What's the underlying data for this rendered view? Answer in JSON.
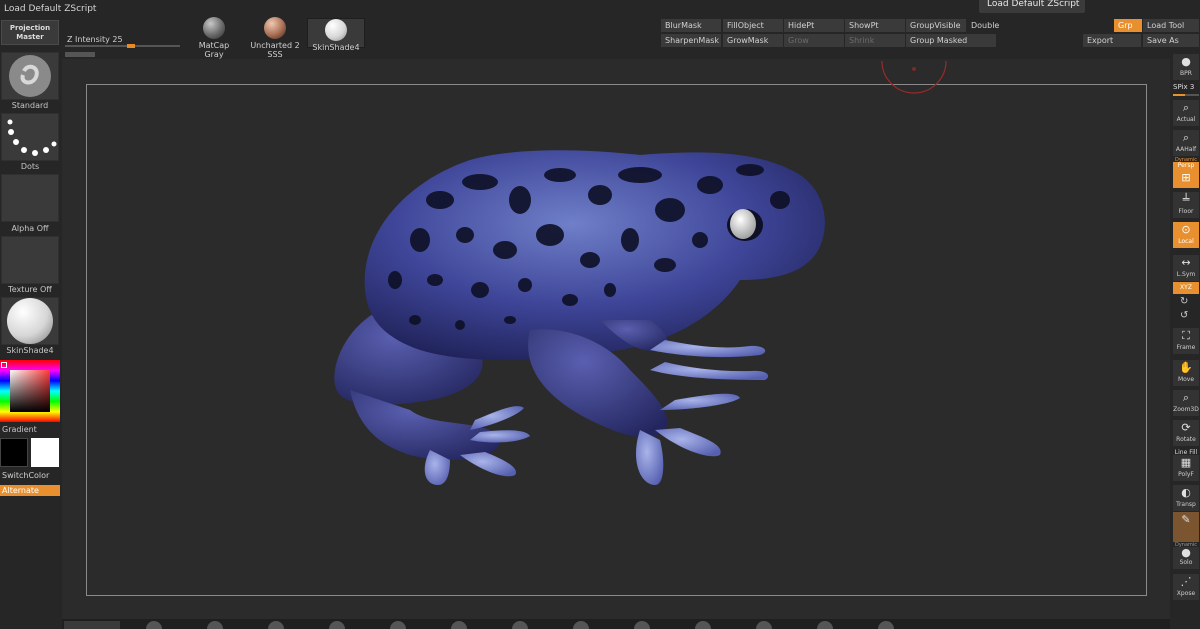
{
  "app": {
    "title": "Load Default ZScript",
    "tooltip": "Load Default ZScript"
  },
  "top": {
    "projection_master": "Projection Master",
    "z_intensity_label": "Z Intensity",
    "z_intensity_value": "25",
    "z_intensity_fraction": 0.25,
    "materials": [
      {
        "label": "MatCap Gray",
        "color": "#7a7a7a"
      },
      {
        "label": "Uncharted 2 SSS",
        "color": "#b07a62"
      },
      {
        "label": "SkinShade4",
        "color": "#f2f2f2"
      }
    ],
    "menu_row1": [
      "BlurMask",
      "FillObject",
      "HidePt",
      "ShowPt",
      "GroupVisible",
      "Double"
    ],
    "menu_row2": [
      "SharpenMask",
      "GrowMask",
      "Grow",
      "Shrink",
      "Group Masked"
    ],
    "grp": "Grp",
    "load_tool": "Load Tool",
    "export": "Export",
    "save_as": "Save As"
  },
  "left": {
    "brush": "Standard",
    "stroke": "Dots",
    "alpha": "Alpha Off",
    "texture": "Texture Off",
    "material": "SkinShade4",
    "gradient": "Gradient",
    "switch_color": "SwitchColor",
    "alternate": "Alternate",
    "main_color": "#000000",
    "secondary_color": "#ffffff"
  },
  "right": {
    "items": [
      "BPR",
      "SPix 3",
      "Actual",
      "AAHalf",
      "Dynamic",
      "Persp",
      "Floor",
      "Local",
      "L.Sym",
      "XYZ",
      "Frame",
      "Move",
      "Zoom3D",
      "Rotate",
      "Line Fill",
      "PolyF",
      "Transp",
      "Dynamic",
      "Solo",
      "Xpose"
    ]
  },
  "colors": {
    "accent": "#e8902f",
    "frog_body": "#3a3f8a",
    "frog_back": "#5a6fb8"
  }
}
